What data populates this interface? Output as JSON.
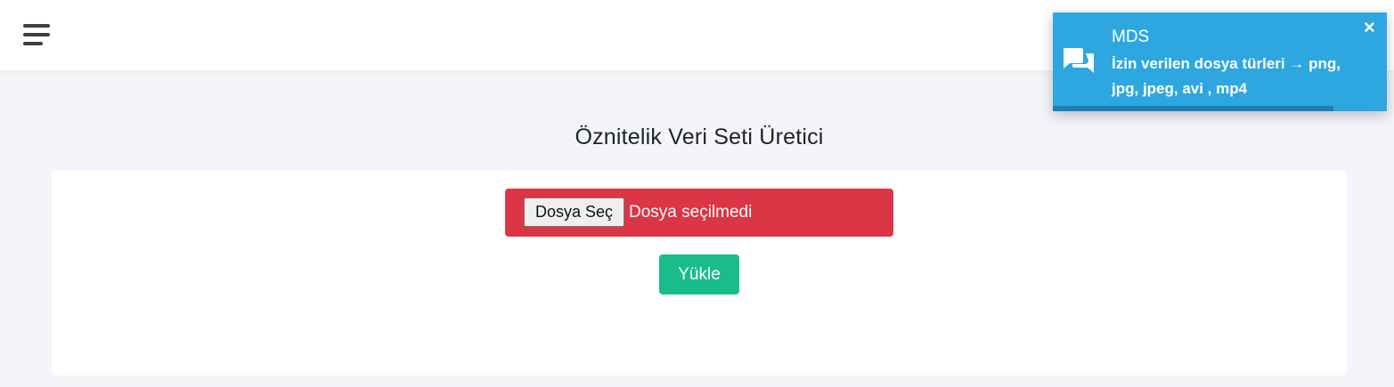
{
  "header": {
    "menu_icon": "hamburger-menu-icon"
  },
  "page": {
    "title": "Öznitelik Veri Seti Üretici"
  },
  "upload_form": {
    "choose_file_label": "Dosya Seç",
    "no_file_text": "Dosya seçilmedi",
    "upload_label": "Yükle",
    "file_box_color": "#dc3545",
    "upload_color": "#1abc8c"
  },
  "toast": {
    "title": "MDS",
    "message": "İzin verilen dosya türleri → png, jpg, jpeg, avi , mp4",
    "close_symbol": "×",
    "icon": "chat-bubbles-icon",
    "background_color": "#2ea7e0",
    "progress_fraction": 0.84
  }
}
